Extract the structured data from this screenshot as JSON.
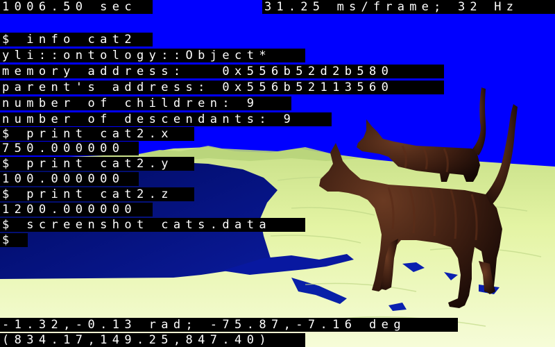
{
  "hud": {
    "time": "1006.50 sec",
    "frame_rate": "31.25 ms/frame; 32 Hz",
    "orientation": "-1.32,-0.13 rad; -75.87,-7.16 deg",
    "position": "(834.17,149.25,847.40)"
  },
  "console": {
    "lines": [
      "$ info cat2",
      "yli::ontology::Object*",
      "memory address:   0x556b52d2b580",
      "parent's address: 0x556b52113560",
      "number of children: 9",
      "number of descendants: 9",
      "$ print cat2.x",
      "750.000000",
      "$ print cat2.y",
      "100.000000",
      "$ print cat2.z",
      "1200.000000",
      "$ screenshot cats.data",
      "$"
    ]
  },
  "scene": {
    "colors": {
      "sky": "#0000ff",
      "terrain": "#e8f6a8",
      "water": "#001070",
      "cat_fur": "#3a1e12"
    },
    "objects": [
      "terrain",
      "water",
      "cat1",
      "cat2"
    ]
  }
}
